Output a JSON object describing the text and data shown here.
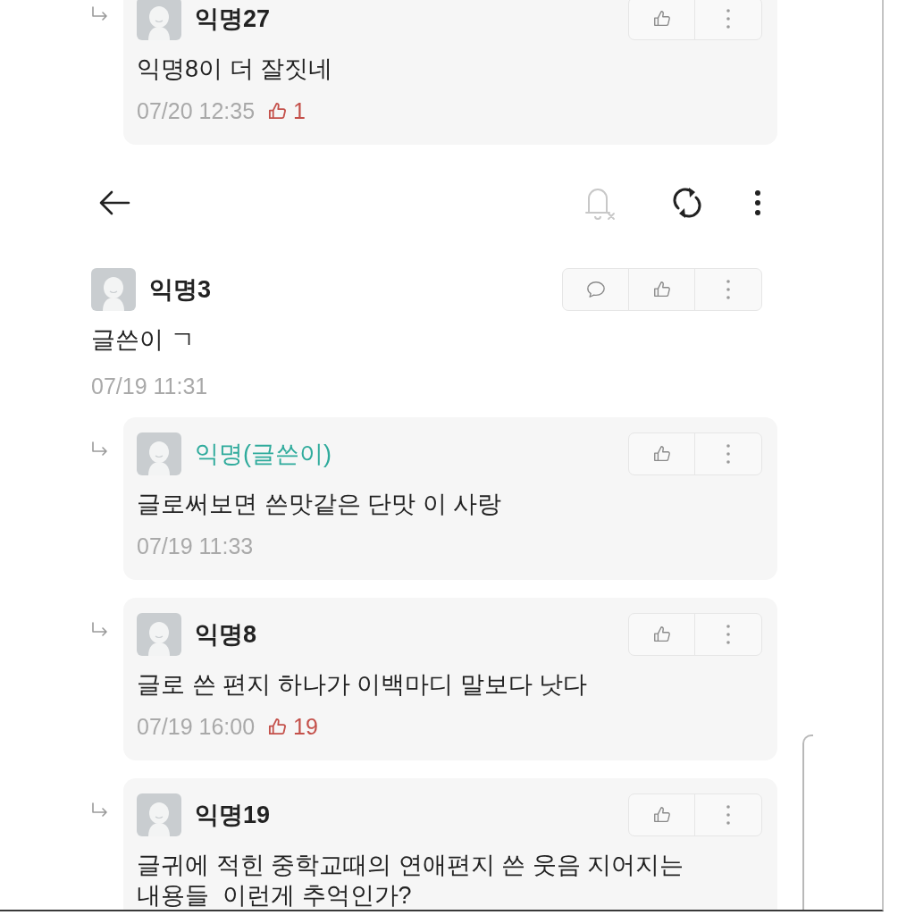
{
  "top_reply": {
    "kind": "reply",
    "author": "익명27",
    "is_writer": false,
    "text": "익명8이 더 잘짓네",
    "time": "07/20 12:35",
    "likes": "1"
  },
  "comments": [
    {
      "kind": "comment",
      "author": "익명3",
      "is_writer": false,
      "text": "글쓴이 ㄱ",
      "time": "07/19 11:31"
    },
    {
      "kind": "reply",
      "author": "익명(글쓴이)",
      "is_writer": true,
      "text": "글로써보면 쓴맛같은 단맛 이 사랑",
      "time": "07/19 11:33"
    },
    {
      "kind": "reply",
      "author": "익명8",
      "is_writer": false,
      "text": "글로 쓴 편지 하나가 이백마디 말보다 낫다",
      "time": "07/19 16:00",
      "likes": "19"
    },
    {
      "kind": "reply",
      "author": "익명19",
      "is_writer": false,
      "text": "글귀에 적힌 중학교때의 연애편지 쓴 웃음 지어지는\n내용들  이런게 추억인가?"
    }
  ]
}
